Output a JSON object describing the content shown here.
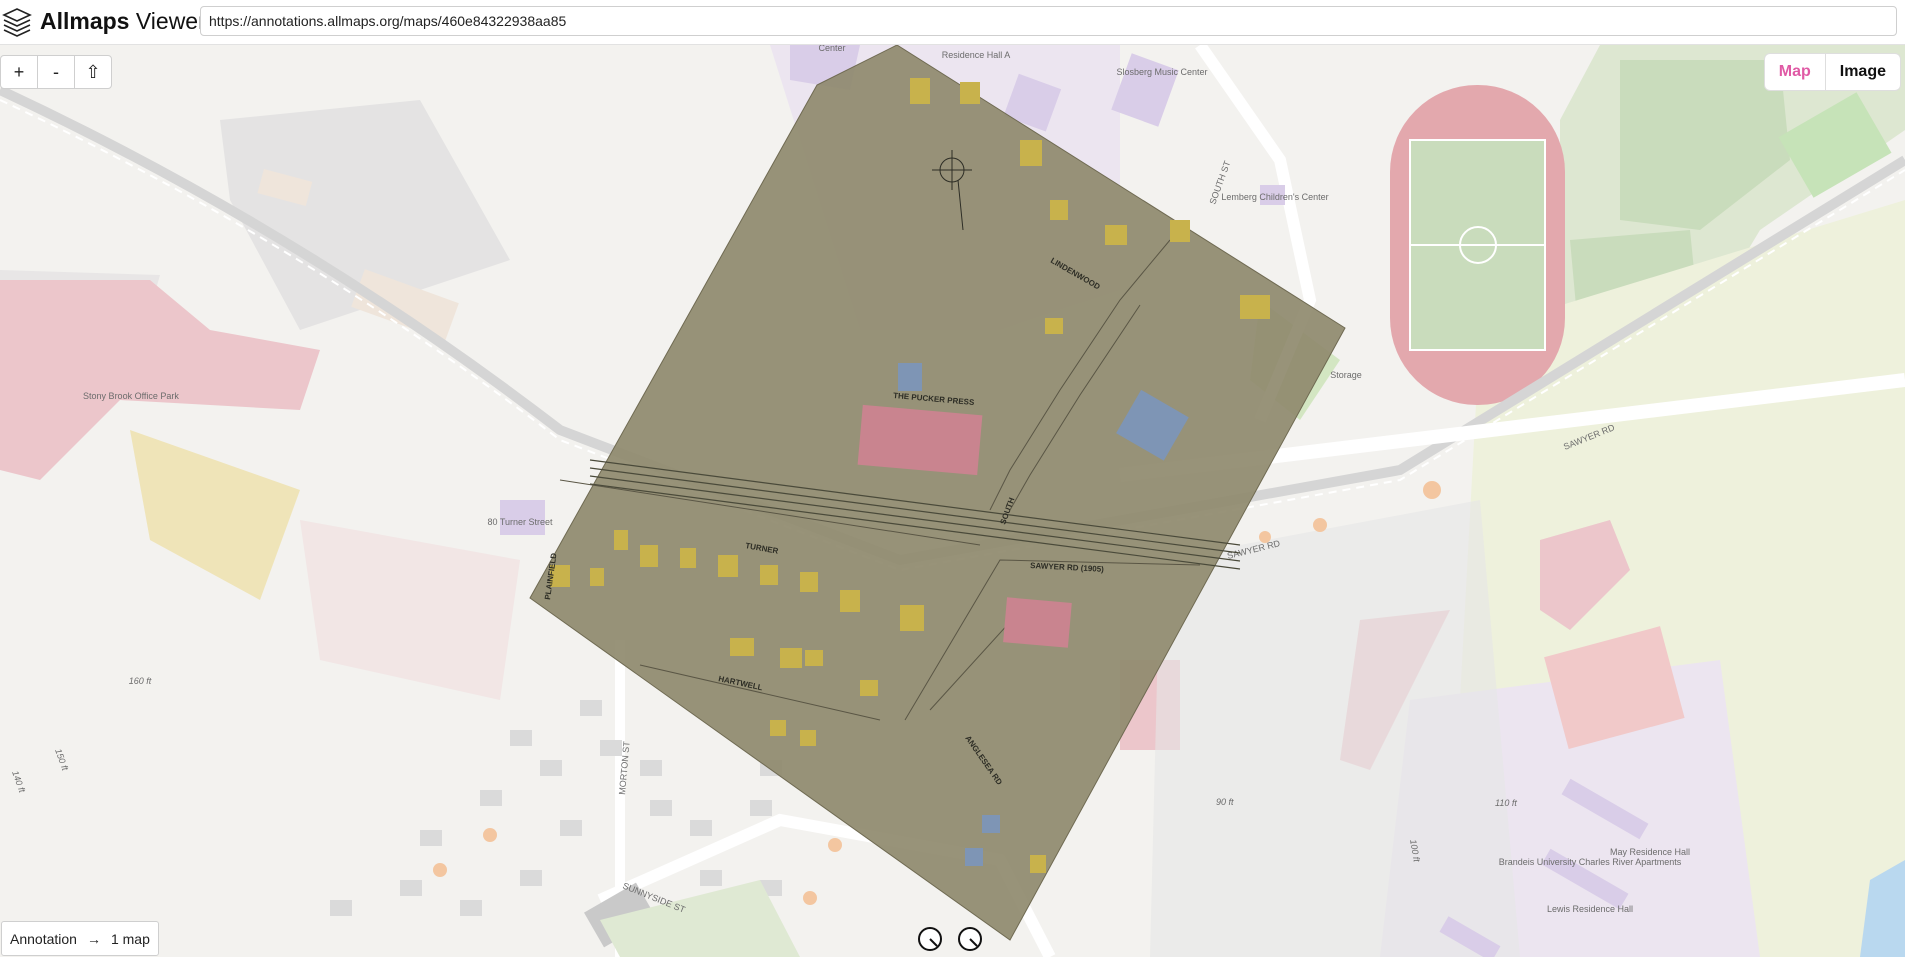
{
  "app": {
    "name_bold": "Allmaps",
    "name_light": "Viewer"
  },
  "url_field": {
    "value": "https://annotations.allmaps.org/maps/460e84322938aa85"
  },
  "zoom": {
    "in": "+",
    "out": "-",
    "reset": "⇧"
  },
  "view_toggle": {
    "map": "Map",
    "image": "Image",
    "active": "map"
  },
  "footer": {
    "annotation": "Annotation",
    "arrow": "→",
    "count": "1 map"
  },
  "colors": {
    "accent": "#e05aa5",
    "track": "#e3a8ad",
    "field": "#c9dcbc",
    "park": "#e8eed4",
    "building": "#e9b8bf",
    "residence": "#d9cde8"
  },
  "base_map": {
    "labels": {
      "center": "Center",
      "residence_hall_a": "Residence Hall A",
      "slosberg": "Slosberg Music Center",
      "lemberg": "Lemberg Children's Center",
      "storage": "Storage",
      "south_st": "SOUTH ST",
      "sawyer_rd_1": "SAWYER RD",
      "sawyer_rd_2": "SAWYER RD",
      "stony_brook": "Stony Brook Office Park",
      "turner_street": "80 Turner Street",
      "elev_160": "160 ft",
      "elev_150": "150 ft",
      "elev_140": "140 ft",
      "elev_90": "90 ft",
      "elev_110": "110 ft",
      "elev_100": "100 ft",
      "morton_st": "MORTON ST",
      "sunnyside_st": "SUNNYSIDE ST",
      "brandeis_apts": "Brandeis University Charles River Apartments",
      "lewis_hall": "Lewis Residence Hall",
      "may_hall": "May Residence Hall"
    }
  },
  "overlay_map": {
    "labels": {
      "lindenwood": "LINDENWOOD",
      "south": "SOUTH",
      "sawyer_rd": "SAWYER RD (1905)",
      "turner": "TURNER",
      "hartwell": "HARTWELL",
      "plainfield": "PLAINFIELD",
      "anglesea": "ANGLESEA RD",
      "pucker_press": "THE PUCKER PRESS"
    }
  }
}
